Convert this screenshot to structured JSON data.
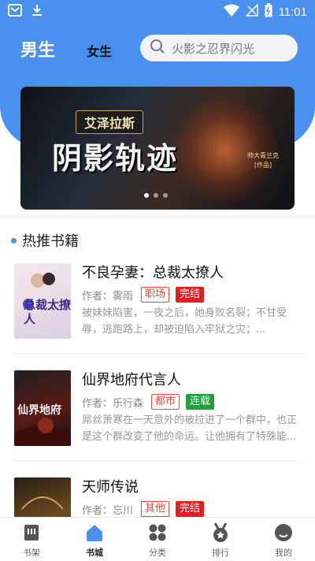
{
  "status_bar": {
    "time": "11:01"
  },
  "top_nav": {
    "tab_male": "男生",
    "tab_female": "女生",
    "search_placeholder": "火影之忍界闪光"
  },
  "banner": {
    "subtitle": "艾泽拉斯",
    "title": "阴影轨迹",
    "author_line1": "帅大青兰克",
    "author_line2": "[作品]",
    "dot_count": 3,
    "active_dot": 0
  },
  "section": {
    "title": "热推书籍"
  },
  "books": [
    {
      "title": "不良孕妻：总裁太撩人",
      "author_label": "作者：雾雨",
      "category": "职场",
      "status": "完结",
      "status_color": "#e02020",
      "category_color": "#e64a3c",
      "desc": "被妹妹陷害，一夜之后，她身败名裂；不甘受辱，逃跑路上，却被迫陷入牢狱之灾；...",
      "cover_text": "总裁太撩人"
    },
    {
      "title": "仙界地府代言人",
      "author_label": "作者：乐行森",
      "category": "都市",
      "status": "连载",
      "status_color": "#22a03a",
      "category_color": "#e64a3c",
      "desc": "屌丝萧寒在一天意外的被拉进了一个群中，也正是这个群改变了他的命运。让他拥有了特殊能...",
      "cover_text": "仙界地府"
    },
    {
      "title": "天师传说",
      "author_label": "作者：忘川",
      "category": "其他",
      "status": "完结",
      "status_color": "#e02020",
      "category_color": "#e64a3c",
      "desc": "",
      "cover_text": ""
    }
  ],
  "bottom_nav": [
    {
      "label": "书架",
      "icon": "bookshelf-icon",
      "active": false
    },
    {
      "label": "书城",
      "icon": "bookstore-icon",
      "active": true
    },
    {
      "label": "分类",
      "icon": "category-icon",
      "active": false
    },
    {
      "label": "排行",
      "icon": "ranking-icon",
      "active": false
    },
    {
      "label": "我的",
      "icon": "profile-icon",
      "active": false
    }
  ],
  "colors": {
    "accent": "#4a90ef",
    "nav_icon": "#555555"
  }
}
